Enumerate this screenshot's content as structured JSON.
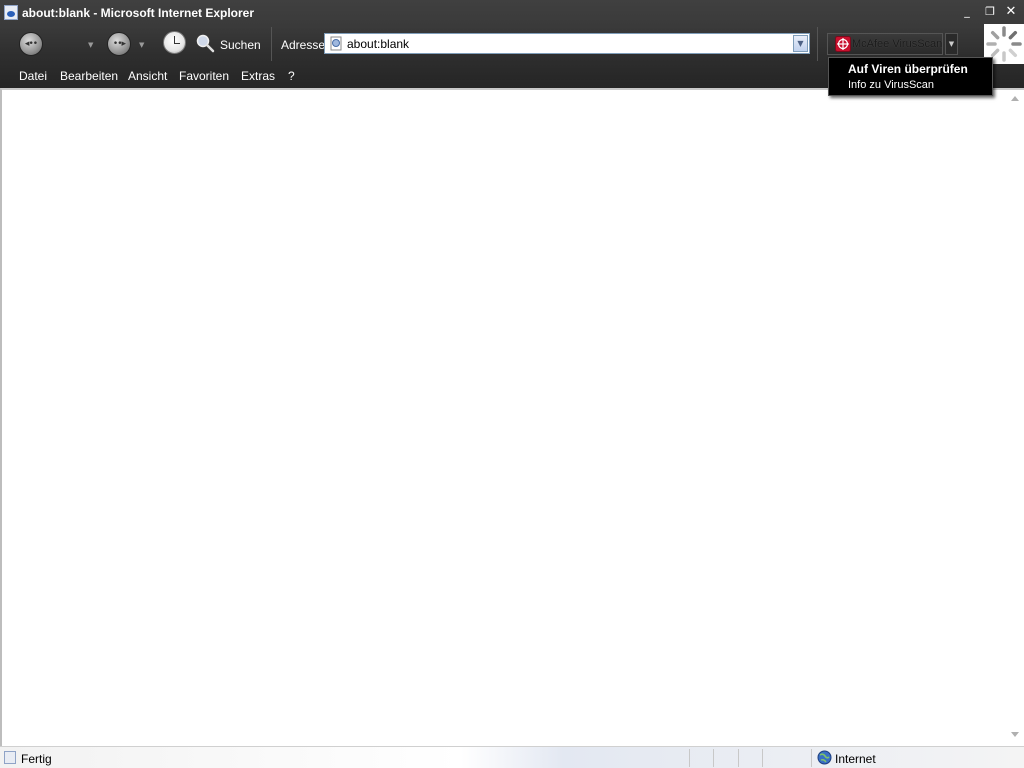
{
  "window": {
    "title": "about:blank - Microsoft Internet Explorer",
    "minimize_icon": "minimize-icon",
    "restore_icon": "restore-icon",
    "close_icon": "close-icon"
  },
  "toolbar": {
    "back_icon": "back-arrow-icon",
    "forward_icon": "forward-arrow-icon",
    "history_icon": "clock-icon",
    "search_label": "Suchen",
    "address_label": "Adresse",
    "address_value": "about:blank",
    "mcafee_label": "McAfee VirusScan"
  },
  "menubar": {
    "items": [
      "Datei",
      "Bearbeiten",
      "Ansicht",
      "Favoriten",
      "Extras",
      "?"
    ]
  },
  "mcafee_menu": {
    "items": [
      "Auf Viren überprüfen",
      "Info zu VirusScan"
    ]
  },
  "statusbar": {
    "status": "Fertig",
    "zone": "Internet"
  },
  "colors": {
    "chrome_dark": "#2f2f2f",
    "menu_popup_bg": "#000000",
    "address_border": "#7f9db9",
    "mcafee_red": "#c8102e"
  }
}
